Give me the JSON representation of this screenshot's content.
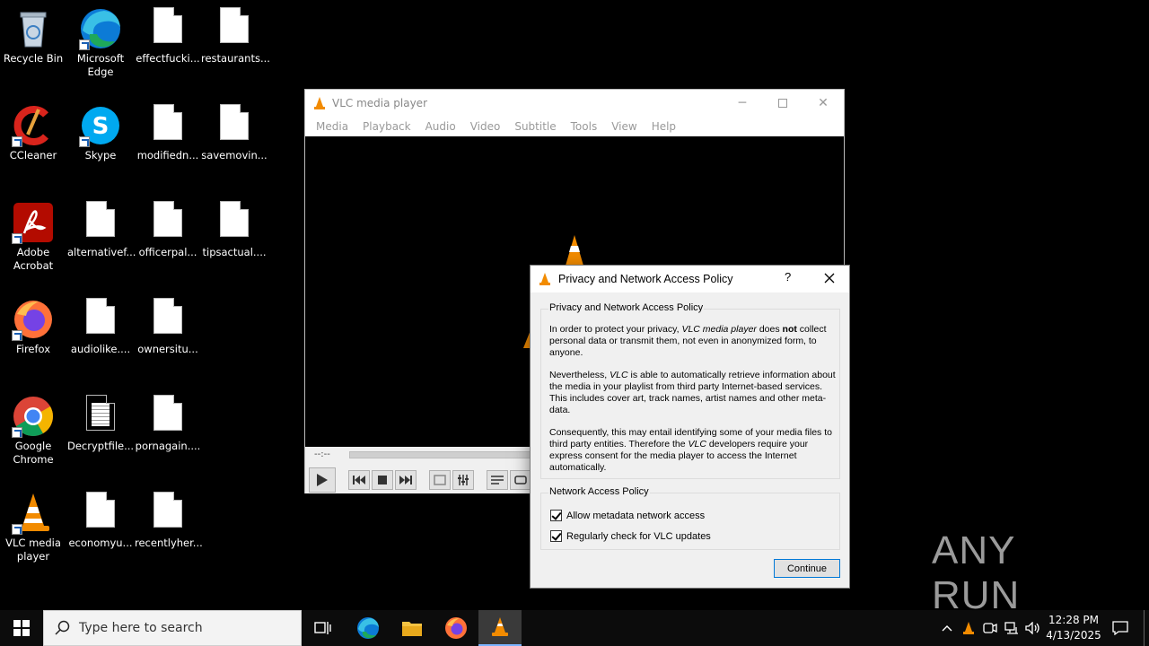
{
  "desktop": {
    "icons": [
      {
        "label": "Recycle Bin"
      },
      {
        "label": "Microsoft Edge"
      },
      {
        "label": "effectfucki..."
      },
      {
        "label": "restaurants..."
      },
      {
        "label": "CCleaner"
      },
      {
        "label": "Skype"
      },
      {
        "label": "modifiedn..."
      },
      {
        "label": "savemovin..."
      },
      {
        "label": "Adobe Acrobat"
      },
      {
        "label": "alternativef..."
      },
      {
        "label": "officerpal..."
      },
      {
        "label": "tipsactual...."
      },
      {
        "label": "Firefox"
      },
      {
        "label": "audiolike...."
      },
      {
        "label": "ownersitu..."
      },
      {
        "label": "Google Chrome"
      },
      {
        "label": "Decryptfile..."
      },
      {
        "label": "pornagain...."
      },
      {
        "label": "VLC media player"
      },
      {
        "label": "economyu..."
      },
      {
        "label": "recentlyher..."
      }
    ]
  },
  "vlc": {
    "title": "VLC media player",
    "menu": [
      "Media",
      "Playback",
      "Audio",
      "Video",
      "Subtitle",
      "Tools",
      "View",
      "Help"
    ],
    "time": "--:--"
  },
  "dialog": {
    "title": "Privacy and Network Access Policy",
    "help": "?",
    "group1_title": "Privacy and Network Access Policy",
    "p1_a": "In order to protect your privacy, ",
    "p1_b": "VLC media player",
    "p1_c": " does ",
    "p1_d": "not",
    "p1_e": " collect personal data or transmit them, not even in anonymized form, to anyone.",
    "p2_a": "Nevertheless, ",
    "p2_b": "VLC",
    "p2_c": " is able to automatically retrieve information about the media in your playlist from third party Internet-based services. This includes cover art, track names, artist names and other meta-data.",
    "p3_a": "Consequently, this may entail identifying some of your media files to third party entities. Therefore the ",
    "p3_b": "VLC",
    "p3_c": " developers require your express consent for the media player to access the Internet automatically.",
    "group2_title": "Network Access Policy",
    "check1": "Allow metadata network access",
    "check2": "Regularly check for VLC updates",
    "continue": "Continue"
  },
  "watermark": "ANY RUN",
  "taskbar": {
    "search_placeholder": "Type here to search",
    "time": "12:28 PM",
    "date": "4/13/2025"
  }
}
